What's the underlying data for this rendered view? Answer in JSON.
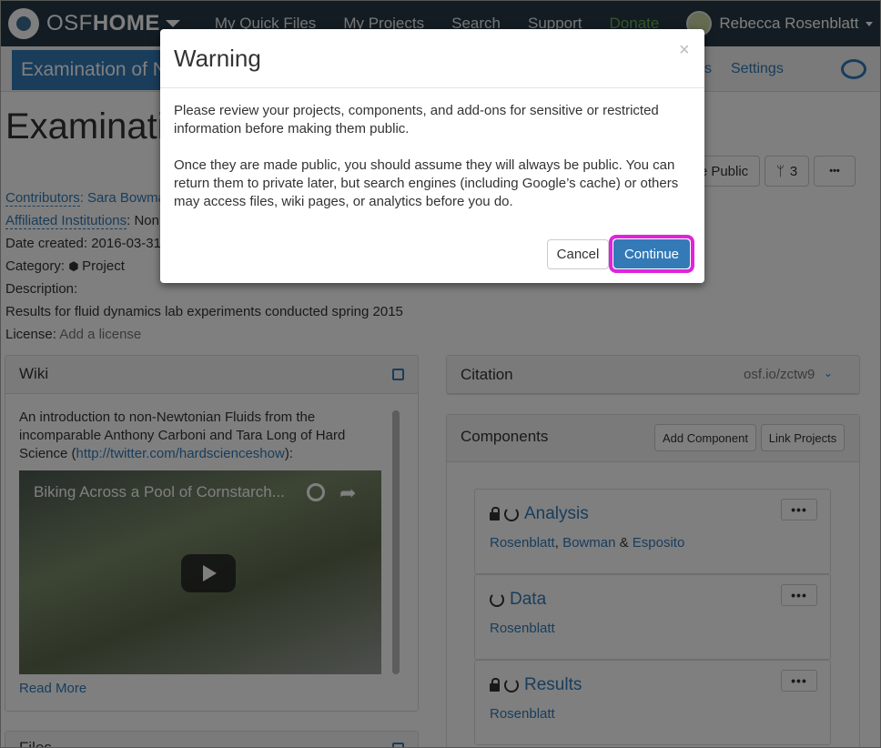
{
  "nav": {
    "brand_light": "OSF",
    "brand_bold": "HOME",
    "links": [
      "My Quick Files",
      "My Projects",
      "Search",
      "Support",
      "Donate"
    ],
    "user_name": "Rebecca Rosenblatt"
  },
  "project_bar": {
    "title": "Examination of N",
    "link_partial": "s",
    "settings": "Settings"
  },
  "project": {
    "title": "Examinatio",
    "make_public_btn": "e Public",
    "fork_count": "3",
    "more_btn": "•••",
    "contributors_label": "Contributors",
    "contributors_value": ": Sara Bowma",
    "institutions_label": "Affiliated Institutions",
    "institutions_value": ": Non",
    "date_created": "Date created: 2016-03-31 (",
    "category_label": "Category: ",
    "category_value": "Project",
    "description_label": "Description:",
    "description": "Results for fluid dynamics lab experiments conducted spring 2015",
    "license_label": "License: ",
    "license_value": "Add a license"
  },
  "wiki": {
    "heading": "Wiki",
    "text_line1": "An introduction to non-Newtonian Fluids from the",
    "text_line2": "incomparable Anthony Carboni and Tara Long of Hard",
    "text_line3_pre": "Science (",
    "text_link": "http://twitter.com/hardscienceshow",
    "text_line3_post": "):",
    "video_title": "Biking Across a Pool of Cornstarch...",
    "read_more": "Read More"
  },
  "files": {
    "heading": "Files"
  },
  "citation": {
    "heading": "Citation",
    "link": "osf.io/zctw9"
  },
  "components": {
    "heading": "Components",
    "add_btn": "Add Component",
    "link_btn": "Link Projects",
    "items": [
      {
        "title": "Analysis",
        "contrib_1": "Rosenblatt",
        "sep_1": ", ",
        "contrib_2": "Bowman",
        "sep_2": " & ",
        "contrib_3": "Esposito",
        "locked": true
      },
      {
        "title": "Data",
        "contrib_1": "Rosenblatt",
        "locked": false
      },
      {
        "title": "Results",
        "contrib_1": "Rosenblatt",
        "locked": true
      }
    ],
    "more_btn": "•••"
  },
  "modal": {
    "title": "Warning",
    "close": "×",
    "paragraph_1": "Please review your projects, components, and add-ons for sensitive or restricted information before making them public.",
    "paragraph_2": "Once they are made public, you should assume they will always be public. You can return them to private later, but search engines (including Google’s cache) or others may access files, wiki pages, or analytics before you do.",
    "cancel": "Cancel",
    "continue": "Continue"
  },
  "colors": {
    "nav_bg": "#263947",
    "link": "#337ab7",
    "donate": "#6ab04c",
    "highlight": "#e023dc"
  }
}
